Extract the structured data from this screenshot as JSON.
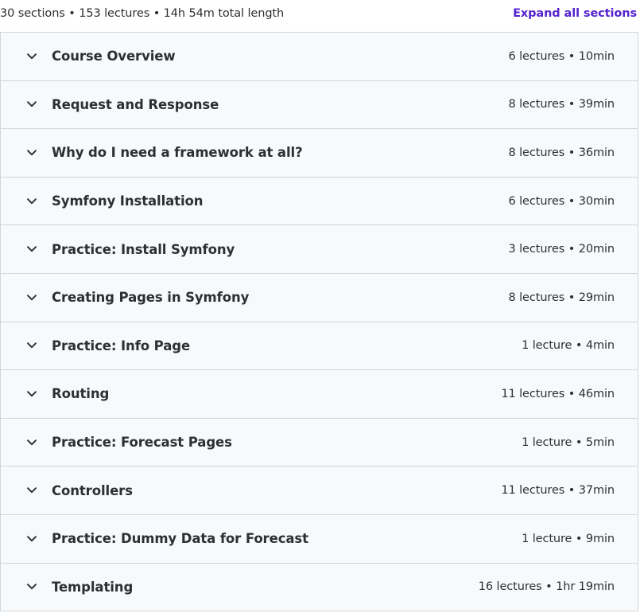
{
  "header": {
    "summary": "30 sections • 153 lectures • 14h 54m total length",
    "expand_all_label": "Expand all sections"
  },
  "icons": {
    "section_toggle": "chevron-down-icon"
  },
  "colors": {
    "accent": "#5624d0",
    "row_background": "#f7f9fa",
    "border": "#d1d7dc",
    "text": "#2d2f31"
  },
  "sections": [
    {
      "title": "Course Overview",
      "meta": "6 lectures • 10min"
    },
    {
      "title": "Request and Response",
      "meta": "8 lectures • 39min"
    },
    {
      "title": "Why do I need a framework at all?",
      "meta": "8 lectures • 36min"
    },
    {
      "title": "Symfony Installation",
      "meta": "6 lectures • 30min"
    },
    {
      "title": "Practice: Install Symfony",
      "meta": "3 lectures • 20min"
    },
    {
      "title": "Creating Pages in Symfony",
      "meta": "8 lectures • 29min"
    },
    {
      "title": "Practice: Info Page",
      "meta": "1 lecture • 4min"
    },
    {
      "title": "Routing",
      "meta": "11 lectures • 46min"
    },
    {
      "title": "Practice: Forecast Pages",
      "meta": "1 lecture • 5min"
    },
    {
      "title": "Controllers",
      "meta": "11 lectures • 37min"
    },
    {
      "title": "Practice: Dummy Data for Forecast",
      "meta": "1 lecture • 9min"
    },
    {
      "title": "Templating",
      "meta": "16 lectures • 1hr 19min"
    }
  ]
}
